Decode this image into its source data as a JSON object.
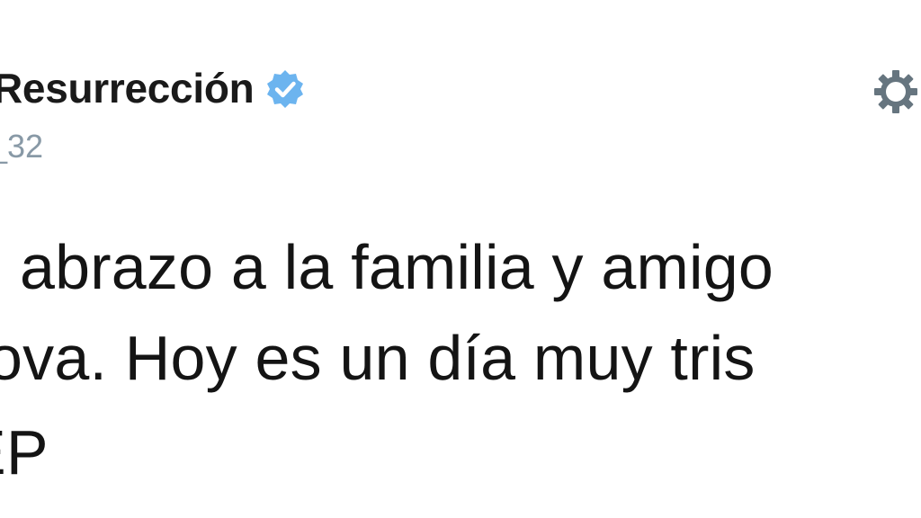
{
  "tweet": {
    "author": {
      "display_name": "Resurrección",
      "handle": "_32",
      "verified_icon": "verified-badge-icon",
      "verified_color": "#6cb4ef"
    },
    "menu_icon": "gear-icon",
    "text_lines": [
      "abrazo a la familia y amigo",
      "ova. Hoy es un día muy tris",
      "EP"
    ]
  }
}
